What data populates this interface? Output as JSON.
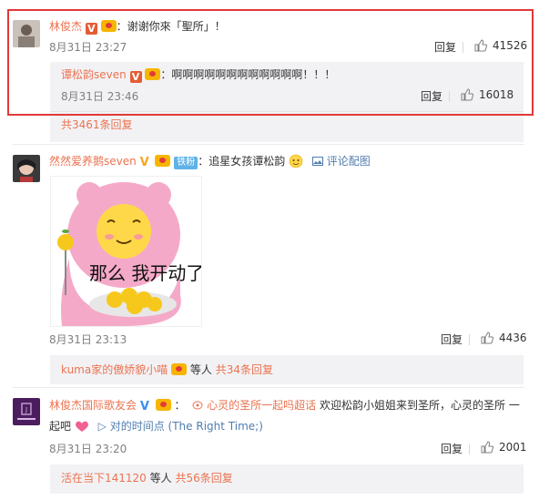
{
  "colors": {
    "username": "#eb7350",
    "highlight_border": "#e0393b",
    "reply_bg": "#f2f2f5",
    "link": "#507daf"
  },
  "comments": [
    {
      "username": "林俊杰",
      "text": "：谢谢你來「聖所」！",
      "time": "8月31日 23:27",
      "reply_label": "回复",
      "likes": "41526",
      "reply": {
        "username": "谭松韵seven",
        "text": "：啊啊啊啊啊啊啊啊啊啊啊啊！！！",
        "time": "8月31日 23:46",
        "reply_label": "回复",
        "likes": "16018"
      },
      "more_replies": "共3461条回复"
    },
    {
      "username": "然然爱养鹅seven",
      "fan_badge": "铁粉",
      "text": "：追星女孩谭松韵",
      "image_comment_link": "评论配图",
      "sticker_text": "那么 我开动了",
      "time": "8月31日 23:13",
      "reply_label": "回复",
      "likes": "4436",
      "reply_summary_user": "kuma家的傲娇貌小喵",
      "reply_summary_mid": "等人",
      "reply_summary_count": "共34条回复"
    },
    {
      "username": "林俊杰国际歌友会",
      "topic": "心灵的圣所一起吗超话",
      "text_part1": "欢迎松韵小姐姐来到圣所，心灵的圣所 一",
      "text_part2": "起吧",
      "song_link": "对的时间点 (The Right Time;)",
      "time": "8月31日 23:20",
      "reply_label": "回复",
      "likes": "2001",
      "reply_summary_user": "活在当下141120",
      "reply_summary_mid": "等人",
      "reply_summary_count": "共56条回复"
    }
  ]
}
